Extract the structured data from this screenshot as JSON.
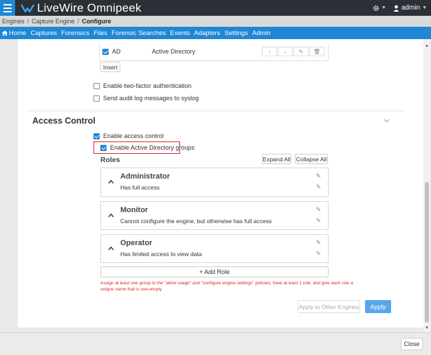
{
  "app": {
    "brand": "LiveWire Omnipeek",
    "user": "admin"
  },
  "breadcrumb": [
    {
      "label": "Engines"
    },
    {
      "label": "Capture Engine"
    },
    {
      "label": "Configure"
    }
  ],
  "nav": {
    "items": [
      {
        "label": "Home"
      },
      {
        "label": "Captures"
      },
      {
        "label": "Forensics"
      },
      {
        "label": "Files"
      },
      {
        "label": "Forensic Searches"
      },
      {
        "label": "Events"
      },
      {
        "label": "Adapters"
      },
      {
        "label": "Settings"
      },
      {
        "label": "Admin"
      }
    ]
  },
  "auth": {
    "ad_row": {
      "name": "AD",
      "type": "Active Directory",
      "checked": true
    },
    "insert_label": "Insert",
    "two_factor_label": "Enable two-factor authentication",
    "audit_log_label": "Send audit log messages to syslog"
  },
  "access_control": {
    "section_title": "Access Control",
    "enable_access_label": "Enable access control",
    "enable_ad_groups_label": "Enable Active Directory groups",
    "roles_title": "Roles",
    "expand_all_label": "Expand All",
    "collapse_all_label": "Collapse All",
    "roles": [
      {
        "title": "Administrator",
        "description": "Has full access"
      },
      {
        "title": "Monitor",
        "description": "Cannot configure the engine, but otherwise has full access"
      },
      {
        "title": "Operator",
        "description": "Has limited access to view data"
      }
    ],
    "add_role_label": "+ Add Role",
    "warning_line1": "Assign at least one group to the \"allow usage\" and \"configure engine settings\" policies; have at least 1 role; and give each role a",
    "warning_line2": "unique name that is non-empty",
    "apply_other_label": "Apply to Other Engines",
    "apply_label": "Apply"
  },
  "footer": {
    "close_label": "Close"
  },
  "colors": {
    "accent": "#1f87d6",
    "topbar": "#2b2f36",
    "highlight_box": "#d9262c",
    "warning_text": "#d9262c"
  }
}
